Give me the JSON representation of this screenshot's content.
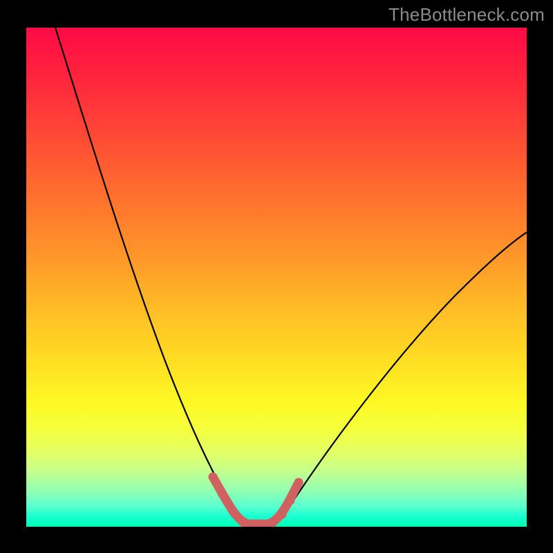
{
  "watermark": "TheBottleneck.com",
  "colors": {
    "page_bg": "#000000",
    "watermark": "#8b8b8b",
    "curve": "#000000",
    "marker": "#cf6161",
    "gradient_top": "#ff0a46",
    "gradient_bottom": "#04ffb6"
  },
  "chart_data": {
    "type": "line",
    "title": "",
    "xlabel": "",
    "ylabel": "",
    "xlim": [
      0,
      100
    ],
    "ylim": [
      0,
      100
    ],
    "x": [
      6,
      8,
      10,
      12,
      14,
      16,
      18,
      20,
      22,
      24,
      26,
      28,
      30,
      32,
      34,
      36,
      38,
      40,
      42,
      43,
      44,
      45,
      48,
      51,
      54,
      57,
      60,
      64,
      68,
      72,
      76,
      80,
      84,
      88,
      92,
      96,
      100
    ],
    "y": [
      100,
      94,
      88,
      82,
      76,
      70,
      64,
      58,
      52,
      46,
      41,
      36,
      31,
      27,
      23,
      19,
      16,
      12,
      8,
      5,
      3,
      1,
      0,
      0,
      2,
      5,
      9,
      14,
      19,
      24,
      29,
      34,
      39,
      44,
      48,
      52,
      56
    ],
    "marker_segment": {
      "x": [
        30,
        32,
        34,
        36,
        38,
        40,
        41,
        42,
        43,
        44,
        47,
        50,
        51,
        52
      ],
      "y": [
        14,
        11,
        8,
        5,
        3,
        1.2,
        0.8,
        0.5,
        0.4,
        0.4,
        0.5,
        2,
        4,
        7
      ]
    }
  }
}
